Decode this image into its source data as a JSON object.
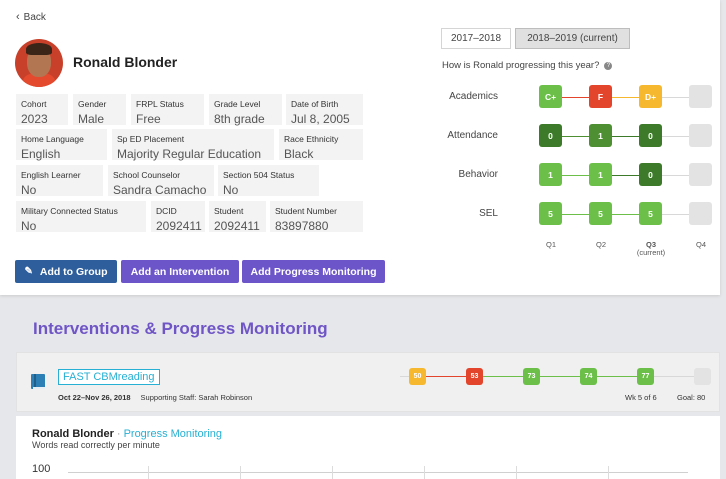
{
  "back_label": "Back",
  "student": {
    "name": "Ronald Blonder"
  },
  "fields": [
    {
      "label": "Cohort",
      "value": "2023"
    },
    {
      "label": "Gender",
      "value": "Male"
    },
    {
      "label": "FRPL Status",
      "value": "Free"
    },
    {
      "label": "Grade Level",
      "value": "8th grade"
    },
    {
      "label": "Date of Birth",
      "value": "Jul 8, 2005"
    },
    {
      "label": "Home Language",
      "value": "English"
    },
    {
      "label": "Sp ED Placement",
      "value": "Majority Regular Education"
    },
    {
      "label": "Race Ethnicity",
      "value": "Black"
    },
    {
      "label": "English Learner",
      "value": "No"
    },
    {
      "label": "School Counselor",
      "value": "Sandra Camacho"
    },
    {
      "label": "Section 504 Status",
      "value": "No"
    },
    {
      "label": "Military Connected Status",
      "value": "No"
    },
    {
      "label": "DCID",
      "value": "2092411"
    },
    {
      "label": "Student",
      "value": "2092411"
    },
    {
      "label": "Student Number",
      "value": "83897880"
    }
  ],
  "actions": {
    "add_group": "Add to Group",
    "add_intervention": "Add an Intervention",
    "add_progress": "Add Progress Monitoring"
  },
  "years": [
    "2017–2018",
    "2018–2019 (current)"
  ],
  "question": "How is Ronald progressing this year?",
  "progress": {
    "quarters": [
      "Q1",
      "Q2",
      "Q3",
      "Q4"
    ],
    "current_note": "(current)",
    "metrics": [
      {
        "name": "Academics",
        "values": [
          "C+",
          "F",
          "D+",
          ""
        ],
        "colors": [
          "#6cc04a",
          "#e2452b",
          "#f5b82e",
          "#e3e3e3"
        ]
      },
      {
        "name": "Attendance",
        "values": [
          "0",
          "1",
          "0",
          ""
        ],
        "colors": [
          "#3d7a2a",
          "#4f8f33",
          "#3d7a2a",
          "#e3e3e3"
        ]
      },
      {
        "name": "Behavior",
        "values": [
          "1",
          "1",
          "0",
          ""
        ],
        "colors": [
          "#6cc04a",
          "#6cc04a",
          "#3d7a2a",
          "#e3e3e3"
        ]
      },
      {
        "name": "SEL",
        "values": [
          "5",
          "5",
          "5",
          ""
        ],
        "colors": [
          "#6cc04a",
          "#6cc04a",
          "#6cc04a",
          "#e3e3e3"
        ]
      }
    ]
  },
  "section_title": "Interventions & Progress Monitoring",
  "intervention": {
    "name": "FAST CBMreading",
    "dates": "Oct 22–Nov 26, 2018",
    "staff": "Supporting Staff: Sarah Robinson",
    "scores": [
      "50",
      "53",
      "73",
      "74",
      "77",
      ""
    ],
    "score_colors": [
      "#f5b82e",
      "#e2452b",
      "#6cc04a",
      "#6cc04a",
      "#6cc04a",
      "#e3e3e3"
    ],
    "week": "Wk 5 of 6",
    "goal": "Goal: 80"
  },
  "chart": {
    "name": "Ronald Blonder",
    "separator": "·",
    "subtitle": "Progress Monitoring",
    "ylabel": "Words read correctly per minute",
    "ytick_top": "100"
  },
  "chart_data": {
    "type": "line",
    "title": "Ronald Blonder · Progress Monitoring",
    "ylabel": "Words read correctly per minute",
    "ylim_top": 100,
    "series": []
  }
}
